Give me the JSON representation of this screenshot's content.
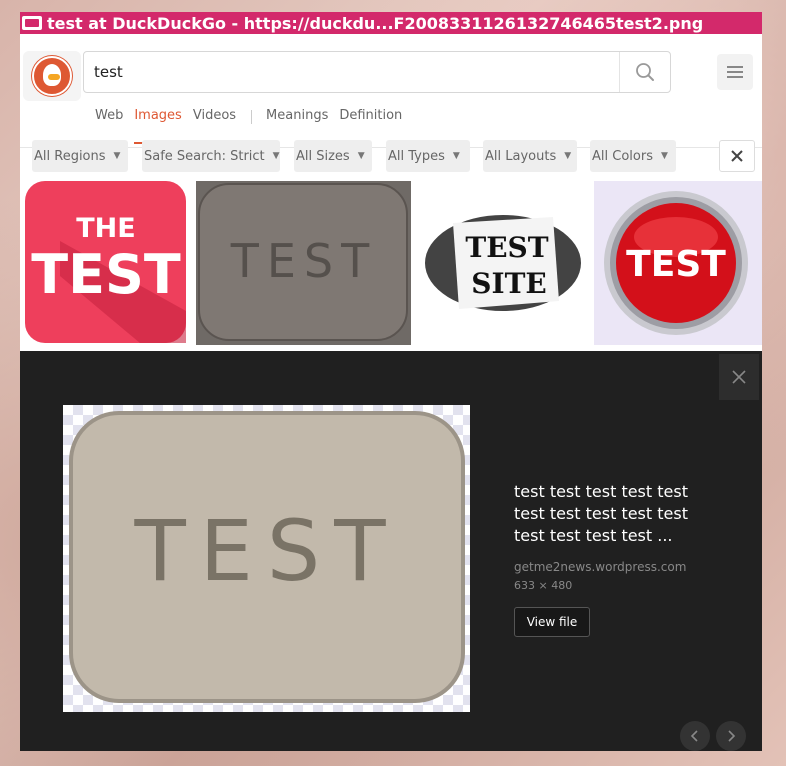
{
  "window": {
    "title": "test at DuckDuckGo - https://duckdu...F2008331126132746465test2.png"
  },
  "search": {
    "value": "test"
  },
  "tabs": [
    {
      "label": "Web"
    },
    {
      "label": "Images"
    },
    {
      "label": "Videos"
    },
    {
      "label": "Meanings"
    },
    {
      "label": "Definition"
    }
  ],
  "filters": [
    {
      "label": "All Regions"
    },
    {
      "label": "Safe Search: Strict"
    },
    {
      "label": "All Sizes"
    },
    {
      "label": "All Types"
    },
    {
      "label": "All Layouts"
    },
    {
      "label": "All Colors"
    }
  ],
  "thumbnails": [
    {
      "line1": "THE",
      "line2": "TEST"
    },
    {
      "text": "TEST"
    },
    {
      "line1": "TEST",
      "line2": "SITE"
    },
    {
      "text": "TEST"
    }
  ],
  "detail": {
    "preview_text": "TEST",
    "title": "test test test test test test test test test test test test test test ...",
    "source": "getme2news.wordpress.com",
    "dimensions": "633 × 480",
    "view_file_label": "View file"
  },
  "colors": {
    "title_bar": "#d3296b",
    "accent": "#de5833",
    "detail_bg": "#202020"
  }
}
